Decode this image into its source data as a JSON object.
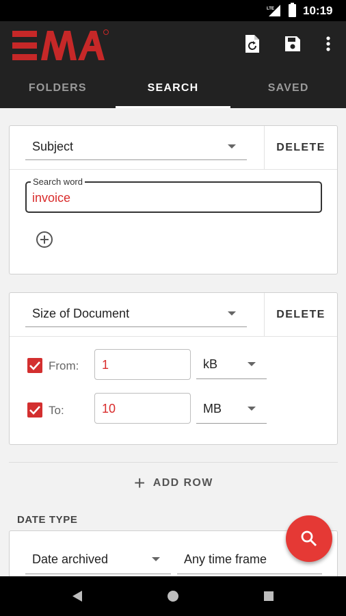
{
  "status_bar": {
    "network": "LTE",
    "time": "10:19"
  },
  "app_bar": {
    "logo_text": "EMA",
    "actions": [
      {
        "name": "reset-search",
        "icon": "document-refresh-icon"
      },
      {
        "name": "save-search",
        "icon": "floppy-disk-icon"
      },
      {
        "name": "overflow-menu",
        "icon": "more-vert-icon"
      }
    ]
  },
  "tabs": [
    {
      "label": "FOLDERS",
      "active": false
    },
    {
      "label": "SEARCH",
      "active": true
    },
    {
      "label": "SAVED",
      "active": false
    }
  ],
  "criteria": [
    {
      "field": "Subject",
      "delete_label": "DELETE",
      "search_word_label": "Search word",
      "search_word_value": "invoice"
    },
    {
      "field": "Size of Document",
      "delete_label": "DELETE",
      "from": {
        "checked": true,
        "label": "From:",
        "value": "1",
        "unit": "kB"
      },
      "to": {
        "checked": true,
        "label": "To:",
        "value": "10",
        "unit": "MB"
      }
    }
  ],
  "add_row_label": "ADD ROW",
  "date_type": {
    "title": "DATE TYPE",
    "type_value": "Date archived",
    "timeframe_value": "Any time frame"
  },
  "colors": {
    "accent": "#d32f2f",
    "fab": "#e53935",
    "bar": "#222222",
    "value_text": "#d92b2b"
  }
}
